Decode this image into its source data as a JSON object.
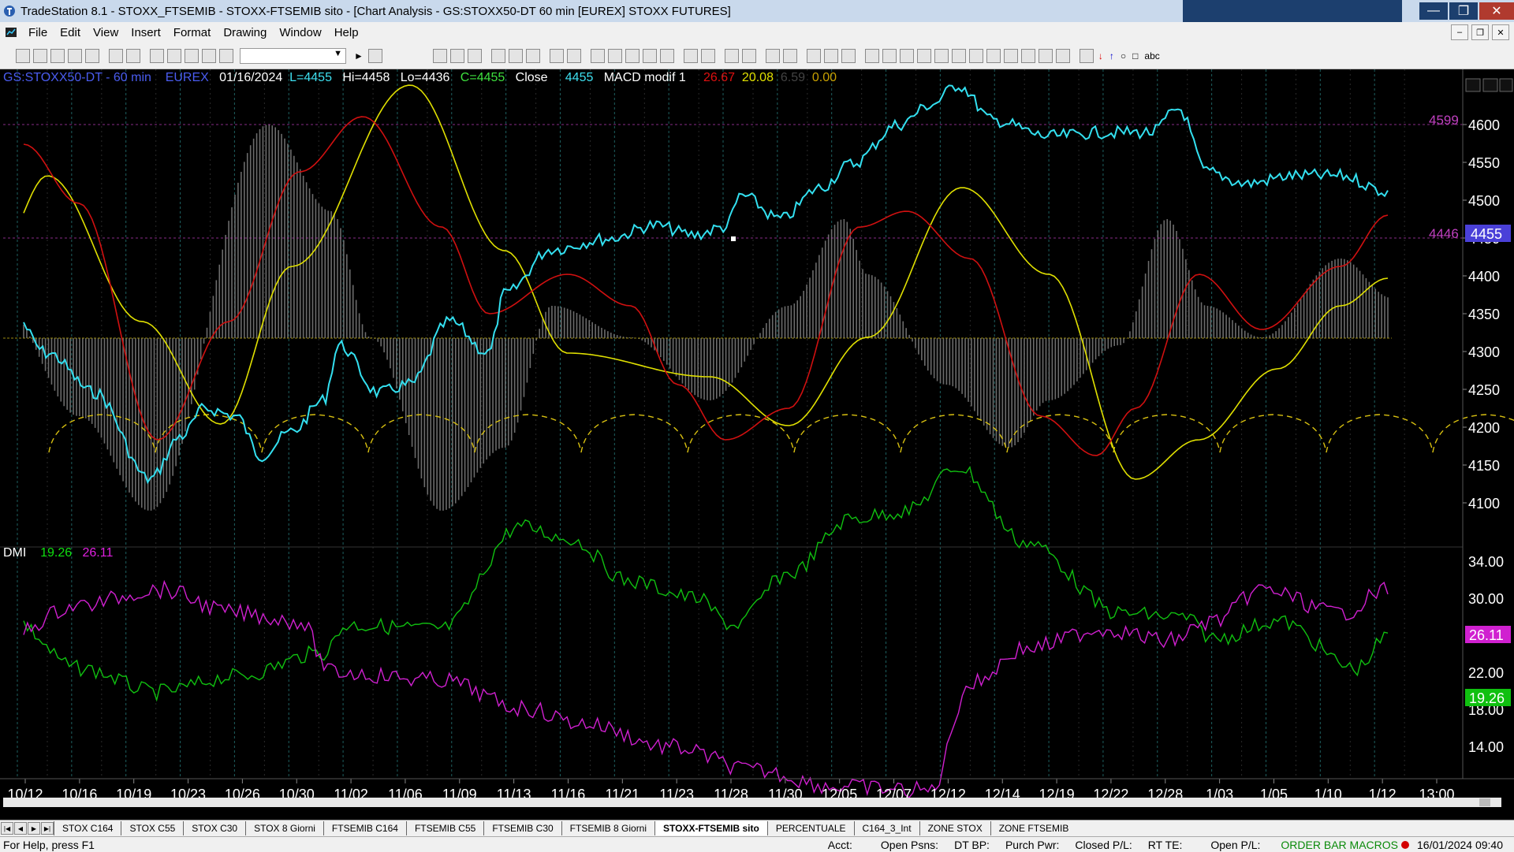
{
  "window": {
    "title": "TradeStation 8.1 - STOXX_FTSEMIB - STOXX-FTSEMIB sito - [Chart Analysis - GS:STOXX50-DT  60 min  [EUREX] STOXX FUTURES]",
    "buttons": [
      "minimize",
      "maximize",
      "close"
    ]
  },
  "menu": {
    "items": [
      "File",
      "Edit",
      "View",
      "Insert",
      "Format",
      "Drawing",
      "Window",
      "Help"
    ]
  },
  "toolbar": {
    "abc_label": "abc"
  },
  "chart": {
    "header": {
      "symbol": "GS:STOXX50-DT - 60 min",
      "exchange": "EUREX",
      "date": "01/16/2024",
      "last": "L=4455",
      "high": "Hi=4458",
      "low": "Lo=4436",
      "close": "C=4455",
      "close_label": "Close",
      "close_value": "4455",
      "macd_name": "MACD modif 1",
      "macd_v1": "26.67",
      "macd_v2": "20.08",
      "macd_v3": "6.59",
      "macd_v4": "0.00"
    },
    "dmi": {
      "label": "DMI",
      "plus": "19.26",
      "minus": "26.11"
    },
    "price_axis": [
      "4600",
      "4550",
      "4500",
      "4450",
      "4400",
      "4350",
      "4300",
      "4250",
      "4200",
      "4150",
      "4100"
    ],
    "dmi_axis": [
      "34.00",
      "30.00",
      "26.00",
      "22.00",
      "18.00",
      "14.00"
    ],
    "level_labels": {
      "upper": "4599",
      "lower": "4446",
      "last_price": "4455",
      "dmi_minus_tag": "26.11",
      "dmi_plus_tag": "19.26"
    },
    "dates": [
      "10/12",
      "10/16",
      "10/19",
      "10/23",
      "10/26",
      "10/30",
      "11/02",
      "11/06",
      "11/09",
      "11/13",
      "11/16",
      "11/21",
      "11/23",
      "11/28",
      "11/30",
      "12/05",
      "12/07",
      "12/12",
      "12/14",
      "12/19",
      "12/22",
      "12/28",
      "1/03",
      "1/05",
      "1/10",
      "1/12",
      "13:00"
    ],
    "colors": {
      "price": "#33e0f0",
      "red_line": "#d01010",
      "yellow_line": "#e0e000",
      "histogram": "#7a7a7a",
      "dmi_plus": "#10c010",
      "dmi_minus": "#d020d0",
      "level": "#c040c0"
    }
  },
  "tabs": {
    "items": [
      "STOX C164",
      "STOX C55",
      "STOX  C30",
      "STOX  8 Giorni",
      "FTSEMIB C164",
      "FTSEMIB C55",
      "FTSEMIB C30",
      "FTSEMIB  8 Giorni",
      "STOXX-FTSEMIB sito",
      "PERCENTUALE",
      "C164_3_Int",
      "ZONE STOX",
      "ZONE FTSEMIB"
    ],
    "active": "STOXX-FTSEMIB sito"
  },
  "status": {
    "help": "For Help, press F1",
    "acct": "Acct:",
    "open_psns": "Open Psns:",
    "dt_bp": "DT BP:",
    "purch_pwr": "Purch Pwr:",
    "closed_pl": "Closed P/L:",
    "rt_te": "RT TE:",
    "open_pl": "Open P/L:",
    "macros": "ORDER BAR  MACROS",
    "datetime": "16/01/2024 09:40"
  }
}
